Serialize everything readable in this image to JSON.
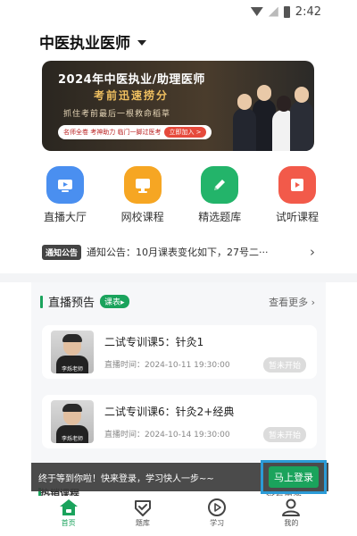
{
  "status_bar": {
    "time": "2:42",
    "icons": [
      "wifi-icon",
      "signal-icon",
      "battery-icon"
    ]
  },
  "header": {
    "title": "中医执业医师"
  },
  "banner": {
    "title": "2024年中医执业/助理医师",
    "subtitle": "考前迅速捞分",
    "line": "抓住考前最后一根救命稻草",
    "pill_text": "名师全卷 考神助力 临门一脚过医考",
    "pill_action": "立即加入 >"
  },
  "grid": [
    {
      "label": "直播大厅",
      "icon": "tv-icon",
      "color": "#4a8ff0"
    },
    {
      "label": "网校课程",
      "icon": "monitor-icon",
      "color": "#f6a623"
    },
    {
      "label": "精选题库",
      "icon": "pencil-icon",
      "color": "#23b46a"
    },
    {
      "label": "试听课程",
      "icon": "play-book-icon",
      "color": "#f25a4a"
    }
  ],
  "notice": {
    "badge": "通知公告",
    "text": "通知公告：10月课表变化如下，27号二···"
  },
  "live": {
    "title": "直播预告",
    "badge": "课表▸",
    "more": "查看更多",
    "items": [
      {
        "title": "二试专训课5：针灸1",
        "time": "直播时间：2024-10-11 19:30:00",
        "status": "暂未开始",
        "teacher": "李烁老师"
      },
      {
        "title": "二试专训课6：针灸2+经典",
        "time": "直播时间：2024-10-14 19:30:00",
        "status": "暂未开始",
        "teacher": "李烁老师"
      }
    ]
  },
  "login_prompt": {
    "text": "终于等到你啦！快来登录，学习快人一步~~",
    "button": "马上登录"
  },
  "peek": {
    "title": "热销课程",
    "more": "查看更多"
  },
  "tabs": [
    {
      "label": "首页",
      "icon": "home-icon",
      "active": true
    },
    {
      "label": "题库",
      "icon": "question-bank-icon",
      "active": false
    },
    {
      "label": "学习",
      "icon": "play-circle-icon",
      "active": false
    },
    {
      "label": "我的",
      "icon": "user-icon",
      "active": false
    }
  ],
  "colors": {
    "accent": "#1aa35c",
    "highlight_border": "#2b9bd6"
  }
}
